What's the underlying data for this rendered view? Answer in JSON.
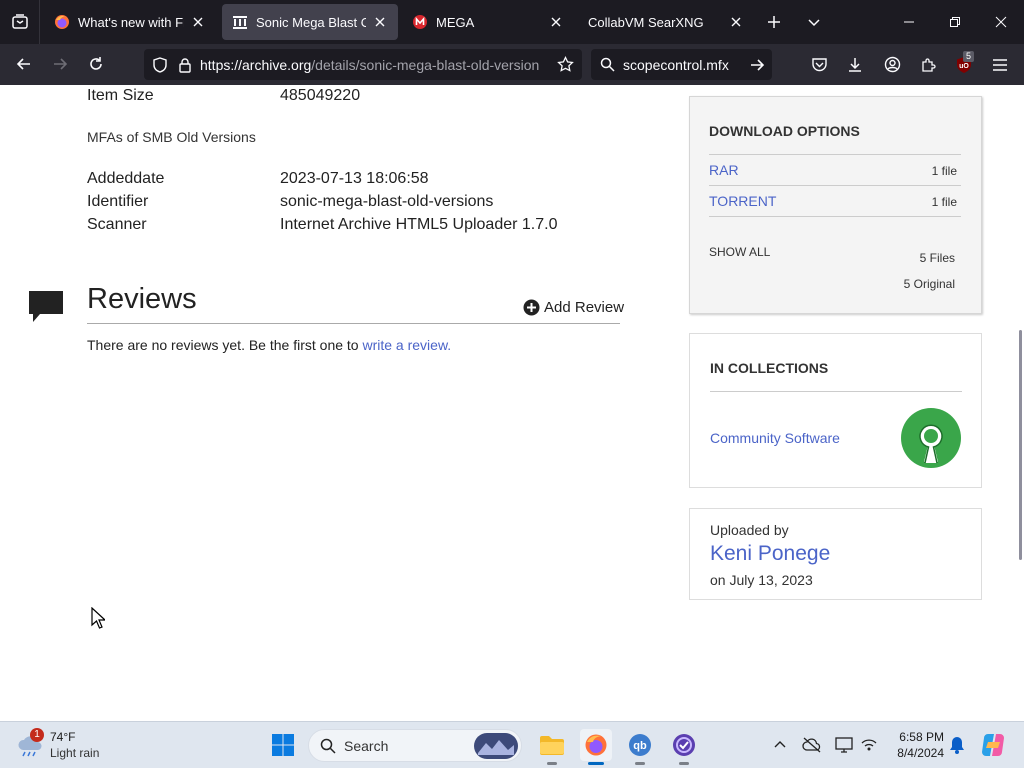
{
  "browser": {
    "tabs": [
      {
        "title": "What's new with Firefo",
        "active": false
      },
      {
        "title": "Sonic Mega Blast Old V",
        "active": true
      },
      {
        "title": "MEGA",
        "active": false
      },
      {
        "title": "CollabVM SearXNG",
        "active": false
      }
    ],
    "url_host": "https://archive.org",
    "url_path": "/details/sonic-mega-blast-old-version",
    "search_value": "scopecontrol.mfx",
    "badge_count": "5",
    "colors": {
      "tabbar": "#1c1b22",
      "navbar": "#2b2a33",
      "active_tab": "#42414d"
    }
  },
  "metadata": {
    "item_size_label": "Item Size",
    "item_size_value": "485049220",
    "note": "MFAs of SMB Old Versions",
    "rows": [
      {
        "label": "Addeddate",
        "value": "2023-07-13 18:06:58"
      },
      {
        "label": "Identifier",
        "value": "sonic-mega-blast-old-versions"
      },
      {
        "label": "Scanner",
        "value": "Internet Archive HTML5 Uploader 1.7.0"
      }
    ]
  },
  "reviews": {
    "title": "Reviews",
    "add_label": "Add Review",
    "empty_text": "There are no reviews yet. Be the first one to ",
    "link_text": "write a review."
  },
  "download": {
    "heading": "DOWNLOAD OPTIONS",
    "formats": [
      {
        "name": "RAR",
        "count": "1 file"
      },
      {
        "name": "TORRENT",
        "count": "1 file"
      }
    ],
    "show_all": "SHOW ALL",
    "total_files": "5 Files",
    "original_files": "5 Original"
  },
  "collections": {
    "heading": "IN COLLECTIONS",
    "items": [
      {
        "name": "Community Software"
      }
    ]
  },
  "uploader": {
    "label": "Uploaded by",
    "name": "Keni Ponege",
    "date": "on July 13, 2023"
  },
  "taskbar": {
    "weather_temp": "74°F",
    "weather_desc": "Light rain",
    "weather_badge": "1",
    "search_placeholder": "Search",
    "time": "6:58 PM",
    "date": "8/4/2024"
  },
  "accent": {
    "link": "#4b64c8",
    "collection_green": "#3aa64a"
  }
}
